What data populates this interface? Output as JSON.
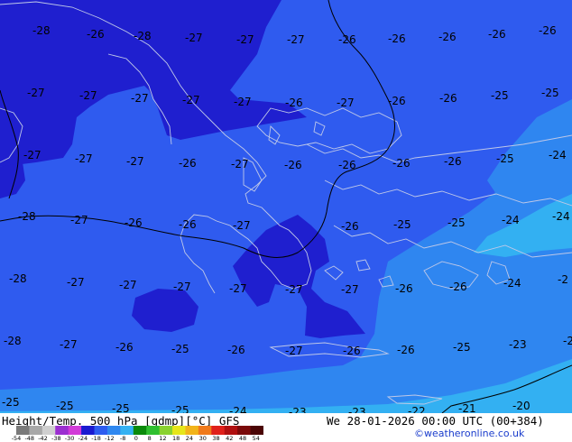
{
  "title": "Height/Temp. 500 hPa [gdmp][°C] GFS",
  "valid_time": "We 28-01-2026 00:00 UTC (00+384)",
  "credit": "©weatheronline.co.uk",
  "colors": {
    "deep_blue": "#1f1fcf",
    "mid_blue": "#2f5bef",
    "light_blue": "#2f86f0",
    "cyan": "#33b0f2",
    "coast": "#bfc8e8",
    "contour": "#000000"
  },
  "isotherm_labels": [
    "-28",
    "-26",
    "-28",
    "-27",
    "-27",
    "-27",
    "-26",
    "-26",
    "-26",
    "-26",
    "-26",
    "-27",
    "-27",
    "-27",
    "-27",
    "-27",
    "-26",
    "-27",
    "-26",
    "-26",
    "-25",
    "-25",
    "-27",
    "-27",
    "-27",
    "-26",
    "-27",
    "-26",
    "-26",
    "-26",
    "-26",
    "-25",
    "-24",
    "-28",
    "-27",
    "-26",
    "-26",
    "-27",
    "-26",
    "-25",
    "-25",
    "-24",
    "-24",
    "-28",
    "-27",
    "-27",
    "-27",
    "-27",
    "-27",
    "-27",
    "-26",
    "-26",
    "-24",
    "-2",
    "-28",
    "-27",
    "-26",
    "-25",
    "-26",
    "-27",
    "-26",
    "-26",
    "-25",
    "-23",
    "-2",
    "-25",
    "-25",
    "-25",
    "-25",
    "-24",
    "-23",
    "-23",
    "-22",
    "-21",
    "-20"
  ],
  "colorbar": {
    "ticks": [
      "-54",
      "-48",
      "-42",
      "-38",
      "-30",
      "-24",
      "-18",
      "-12",
      "-8",
      "0",
      "8",
      "12",
      "18",
      "24",
      "30",
      "38",
      "42",
      "48",
      "54"
    ],
    "colors": [
      "#7a7a7a",
      "#a8a8a8",
      "#cfcfcf",
      "#9b2fd0",
      "#d23bd8",
      "#1a1ad0",
      "#2e5df0",
      "#2f88f0",
      "#34b2f2",
      "#0a8a0a",
      "#2fbf2f",
      "#8ad22f",
      "#e6e61a",
      "#f2b41a",
      "#f07a1a",
      "#e0201a",
      "#b01010",
      "#7a0a0a",
      "#4a0505"
    ]
  }
}
